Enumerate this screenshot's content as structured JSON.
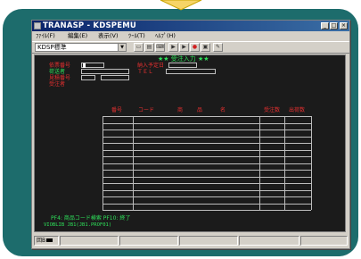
{
  "colors": {
    "panel": "#1d6c6c",
    "titlebar": "#0a246a",
    "screen_bg": "#1b1b1b",
    "label_red": "#e83030",
    "label_green": "#2ee05a"
  },
  "window": {
    "title": "TRANASP - KDSPEMU",
    "minimize": "_",
    "maximize": "□",
    "close": "×"
  },
  "menu": [
    "ﾌｧｲﾙ(F)",
    "編集(E)",
    "表示(V)",
    "ﾂｰﾙ(T)",
    "ﾍﾙﾌﾟ(H)"
  ],
  "toolbar": {
    "profile_value": "KDSP標準",
    "icons": [
      "copy-icon",
      "paste-icon",
      "keyboard-icon",
      "play-icon",
      "step-icon",
      "record-icon",
      "capture-icon",
      "tool-icon"
    ]
  },
  "screen": {
    "heading": "★★ 受注入力 ★★",
    "fields": {
      "order_no": "依票番号",
      "shipper": "荷送者",
      "quote_no": "見積番号",
      "receiver": "受注者",
      "delivery_date": "納入予定日",
      "tel": "ＴＥＬ"
    },
    "table_headers": [
      "番号",
      "コード",
      "商",
      "品",
      "名",
      "受注数",
      "出荷数"
    ],
    "row_count": 14,
    "function_keys": "PF4: 商品コード検索    PF10: 終了",
    "library_line": "VIOBLIB  JB1(JB1.PROF01)"
  },
  "status": {
    "icon_label": "回B"
  }
}
